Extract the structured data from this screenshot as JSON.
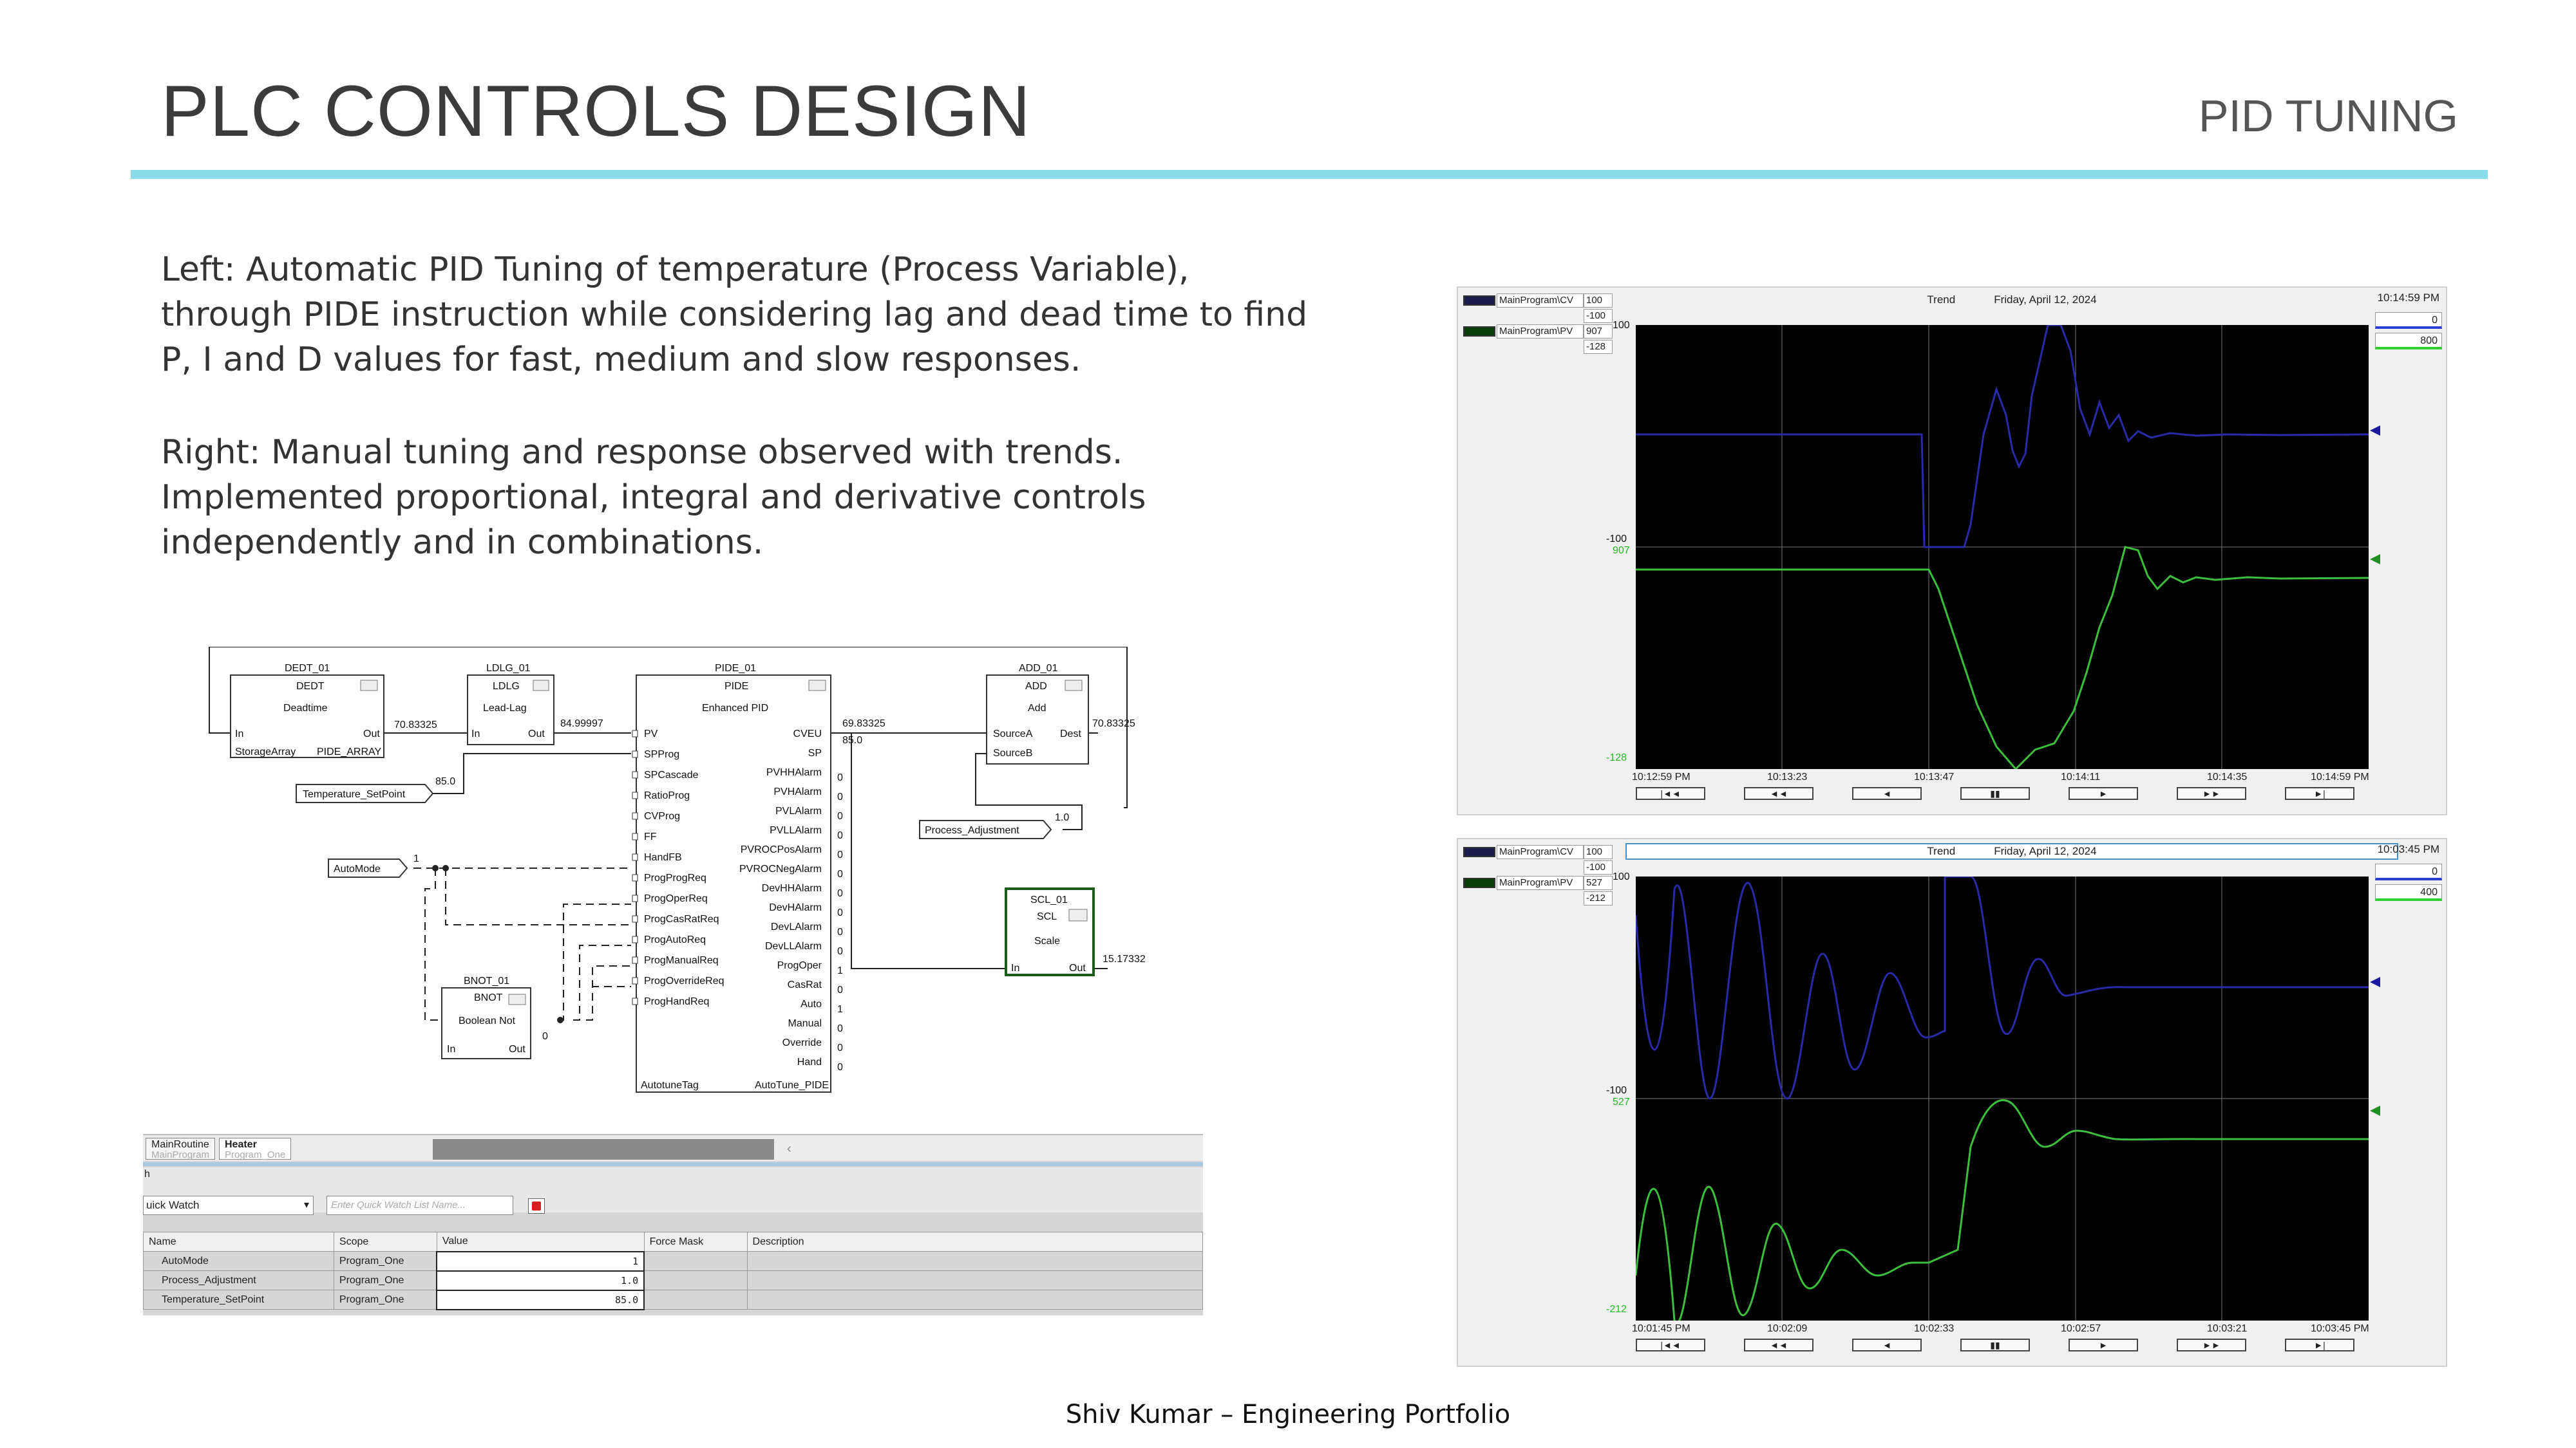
{
  "header": {
    "title": "PLC CONTROLS DESIGN",
    "subtitle": "PID TUNING"
  },
  "description": {
    "left_lines": [
      "Left: Automatic PID Tuning of temperature (Process Variable),",
      "through PIDE instruction while considering lag and dead time to find",
      "P, I and D values for fast, medium and slow responses."
    ],
    "right_lines": [
      "Right: Manual tuning and response observed with trends.",
      "Implemented proportional, integral and derivative controls",
      "independently and in combinations."
    ]
  },
  "trend1": {
    "legend": [
      {
        "name": "MainProgram\\CV",
        "value": "100",
        "color": "#1c1c4a"
      },
      {
        "name": "",
        "value": "-100"
      },
      {
        "name": "MainProgram\\PV",
        "value": "907",
        "color": "#0b3d0b"
      },
      {
        "name": "",
        "value": "-128"
      }
    ],
    "label": "Trend",
    "date": "Friday, April 12, 2024",
    "time": "10:14:59 PM",
    "box_a": "0",
    "box_b": "800",
    "y_labels": {
      "cv_top": "100",
      "cv_bottom": "-100",
      "pv_top": "907",
      "pv_bottom": "-128"
    },
    "x_ticks": [
      "10:12:59 PM",
      "10:13:23",
      "10:13:47",
      "10:14:11",
      "10:14:35",
      "10:14:59 PM"
    ],
    "nav": [
      "|◄◄",
      "◄◄",
      "◄",
      "▮▮",
      "►",
      "►►",
      "►|"
    ],
    "colors": {
      "cv": "#2a2aa8",
      "pv": "#3cbf3c"
    }
  },
  "trend2": {
    "legend": [
      {
        "name": "MainProgram\\CV",
        "value": "100",
        "color": "#1c1c4a"
      },
      {
        "name": "",
        "value": "-100"
      },
      {
        "name": "MainProgram\\PV",
        "value": "527",
        "color": "#0b3d0b"
      },
      {
        "name": "",
        "value": "-212"
      }
    ],
    "label": "Trend",
    "date": "Friday, April 12, 2024",
    "time": "10:03:45 PM",
    "box_a": "0",
    "box_b": "400",
    "y_labels": {
      "cv_top": "100",
      "cv_bottom": "-100",
      "pv_top": "527",
      "pv_bottom": "-212"
    },
    "x_ticks": [
      "10:01:45 PM",
      "10:02:09",
      "10:02:33",
      "10:02:57",
      "10:03:21",
      "10:03:45 PM"
    ],
    "nav": [
      "|◄◄",
      "◄◄",
      "◄",
      "▮▮",
      "►",
      "►►",
      "►|"
    ],
    "colors": {
      "cv": "#2a2aa8",
      "pv": "#3cbf3c"
    }
  },
  "fbd": {
    "dedt": {
      "tag": "DEDT_01",
      "type": "DEDT",
      "desc": "Deadtime",
      "in": "In",
      "out": "Out",
      "storage": "StorageArray",
      "array": "PIDE_ARRAY",
      "out_val": "70.83325"
    },
    "ldlg": {
      "tag": "LDLG_01",
      "type": "LDLG",
      "desc": "Lead-Lag",
      "in": "In",
      "out": "Out",
      "out_val": "84.99997"
    },
    "pide": {
      "tag": "PIDE_01",
      "type": "PIDE",
      "desc": "Enhanced PID",
      "inputs": [
        "PV",
        "SPProg",
        "SPCascade",
        "RatioProg",
        "CVProg",
        "FF",
        "HandFB",
        "ProgProgReq",
        "ProgOperReq",
        "ProgCasRatReq",
        "ProgAutoReq",
        "ProgManualReq",
        "ProgOverrideReq",
        "ProgHandReq"
      ],
      "outputs": [
        "CVEU",
        "SP",
        "PVHHAlarm",
        "PVHAlarm",
        "PVLAlarm",
        "PVLLAlarm",
        "PVROCPosAlarm",
        "PVROCNegAlarm",
        "DevHHAlarm",
        "DevHAlarm",
        "DevLAlarm",
        "DevLLAlarm",
        "ProgOper",
        "CasRat",
        "Auto",
        "Manual",
        "Override",
        "Hand"
      ],
      "output_vals": [
        "",
        "",
        "0",
        "0",
        "0",
        "0",
        "0",
        "0",
        "0",
        "0",
        "0",
        "0",
        "1",
        "0",
        "1",
        "0",
        "0",
        "0"
      ],
      "autotune_label": "AutotuneTag",
      "autotune_val": "AutoTune_PIDE",
      "cveu_val": "69.83325",
      "sp_val": "85.0"
    },
    "add": {
      "tag": "ADD_01",
      "type": "ADD",
      "desc": "Add",
      "in_a": "SourceA",
      "in_b": "SourceB",
      "out": "Dest",
      "out_val": "70.83325"
    },
    "scl": {
      "tag": "SCL_01",
      "type": "SCL",
      "desc": "Scale",
      "in": "In",
      "out": "Out",
      "out_val": "15.17332"
    },
    "bnot": {
      "tag": "BNOT_01",
      "type": "BNOT",
      "desc": "Boolean Not",
      "in": "In",
      "out": "Out",
      "out_val": "0"
    },
    "setpoint": {
      "name": "Temperature_SetPoint",
      "value": "85.0"
    },
    "adjust": {
      "name": "Process_Adjustment",
      "value": "1.0"
    },
    "automode": {
      "name": "AutoMode",
      "value": "1"
    }
  },
  "watch": {
    "tabs": [
      {
        "label": "MainRoutine",
        "sub": "MainProgram"
      },
      {
        "label": "Heater",
        "sub": "Program_One"
      }
    ],
    "letter": "h",
    "select_label": "uick Watch",
    "input_placeholder": "Enter Quick Watch List Name...",
    "columns": [
      "Name",
      "Scope",
      "Value",
      "Force Mask",
      "Description"
    ],
    "rows": [
      {
        "name": "AutoMode",
        "scope": "Program_One",
        "value": "1"
      },
      {
        "name": "Process_Adjustment",
        "scope": "Program_One",
        "value": "1.0"
      },
      {
        "name": "Temperature_SetPoint",
        "scope": "Program_One",
        "value": "85.0"
      }
    ]
  },
  "footer": {
    "text": "Shiv Kumar – Engineering Portfolio"
  }
}
